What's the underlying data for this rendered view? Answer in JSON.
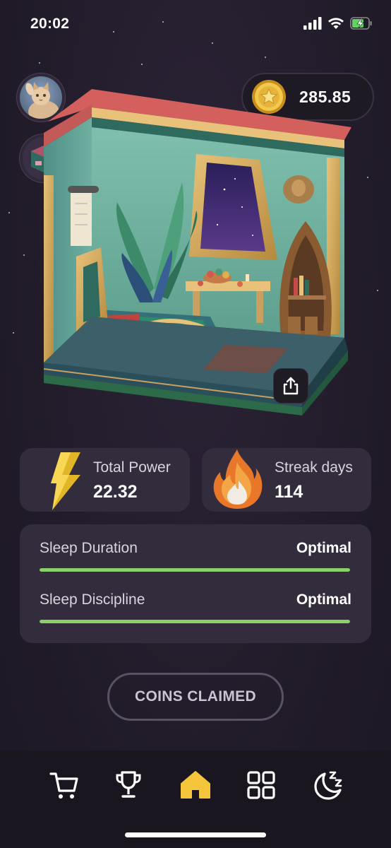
{
  "status_bar": {
    "time": "20:02",
    "icons": [
      "signal-icon",
      "wifi-icon",
      "battery-charging-icon"
    ]
  },
  "profile": {
    "avatar_icon": "cat-avatar-icon",
    "room_thumbnail_icon": "room-thumbnail-icon"
  },
  "wallet": {
    "coin_icon": "star-coin-icon",
    "balance": "285.85"
  },
  "room": {
    "image_icon": "egyptian-bedroom-illustration",
    "share_icon": "share-icon"
  },
  "stats": {
    "power": {
      "icon": "lightning-icon",
      "label": "Total Power",
      "value": "22.32"
    },
    "streak": {
      "icon": "fire-icon",
      "label": "Streak days",
      "value": "114"
    }
  },
  "sleep": {
    "duration": {
      "label": "Sleep Duration",
      "status": "Optimal",
      "level_percent": 100
    },
    "discipline": {
      "label": "Sleep Discipline",
      "status": "Optimal",
      "level_percent": 100
    }
  },
  "actions": {
    "claim_label": "COINS CLAIMED"
  },
  "nav": {
    "items": [
      {
        "icon": "cart-icon",
        "active": false
      },
      {
        "icon": "trophy-icon",
        "active": false
      },
      {
        "icon": "home-icon",
        "active": true
      },
      {
        "icon": "grid-icon",
        "active": false
      },
      {
        "icon": "moon-sleep-icon",
        "active": false
      }
    ]
  },
  "colors": {
    "background": "#221c2b",
    "card": "#332c3c",
    "accent_green": "#8cd06a",
    "active_nav": "#f4c43a",
    "coin_gold": "#e8b93c"
  }
}
